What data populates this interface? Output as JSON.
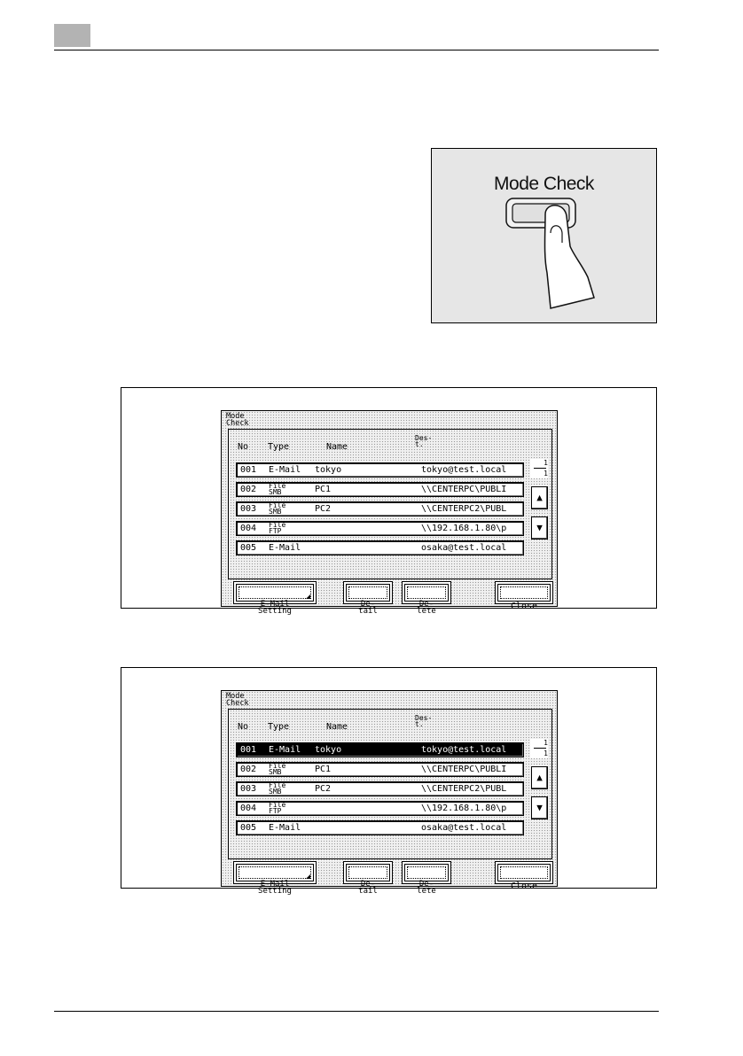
{
  "mode_check_key": {
    "caption": "Mode Check"
  },
  "screens": [
    {
      "title": "Mode\nCheck",
      "columns": {
        "no": "No",
        "type": "Type",
        "name": "Name",
        "dest": "Des-\nt."
      },
      "pager": {
        "current": "1",
        "total": "1"
      },
      "rows": [
        {
          "no": "001",
          "type": "E-Mail",
          "type_top": "",
          "type_bottom": "",
          "name": "tokyo",
          "dest": "tokyo@test.local",
          "selected": false
        },
        {
          "no": "002",
          "type": "",
          "type_top": "File",
          "type_bottom": "SMB",
          "name": "PC1",
          "dest": "\\\\CENTERPC\\PUBLI",
          "selected": false
        },
        {
          "no": "003",
          "type": "",
          "type_top": "File",
          "type_bottom": "SMB",
          "name": "PC2",
          "dest": "\\\\CENTERPC2\\PUBL",
          "selected": false
        },
        {
          "no": "004",
          "type": "",
          "type_top": "File",
          "type_bottom": "FTP",
          "name": "",
          "dest": "\\\\192.168.1.80\\p",
          "selected": false
        },
        {
          "no": "005",
          "type": "E-Mail",
          "type_top": "",
          "type_bottom": "",
          "name": "",
          "dest": "osaka@test.local",
          "selected": false
        }
      ],
      "buttons": {
        "email_setting": "E-Mail\nSetting",
        "detail": "De-\ntail",
        "delete": "De-\nlete",
        "close": "Close"
      }
    },
    {
      "title": "Mode\nCheck",
      "columns": {
        "no": "No",
        "type": "Type",
        "name": "Name",
        "dest": "Des-\nt."
      },
      "pager": {
        "current": "1",
        "total": "1"
      },
      "rows": [
        {
          "no": "001",
          "type": "E-Mail",
          "type_top": "",
          "type_bottom": "",
          "name": "tokyo",
          "dest": "tokyo@test.local",
          "selected": true
        },
        {
          "no": "002",
          "type": "",
          "type_top": "File",
          "type_bottom": "SMB",
          "name": "PC1",
          "dest": "\\\\CENTERPC\\PUBLI",
          "selected": false
        },
        {
          "no": "003",
          "type": "",
          "type_top": "File",
          "type_bottom": "SMB",
          "name": "PC2",
          "dest": "\\\\CENTERPC2\\PUBL",
          "selected": false
        },
        {
          "no": "004",
          "type": "",
          "type_top": "File",
          "type_bottom": "FTP",
          "name": "",
          "dest": "\\\\192.168.1.80\\p",
          "selected": false
        },
        {
          "no": "005",
          "type": "E-Mail",
          "type_top": "",
          "type_bottom": "",
          "name": "",
          "dest": "osaka@test.local",
          "selected": false
        }
      ],
      "buttons": {
        "email_setting": "E-Mail\nSetting",
        "detail": "De-\ntail",
        "delete": "De-\nlete",
        "close": "Close"
      }
    }
  ],
  "icons": {
    "up": "up-arrow-icon",
    "down": "down-arrow-icon",
    "finger": "finger-press-icon"
  }
}
